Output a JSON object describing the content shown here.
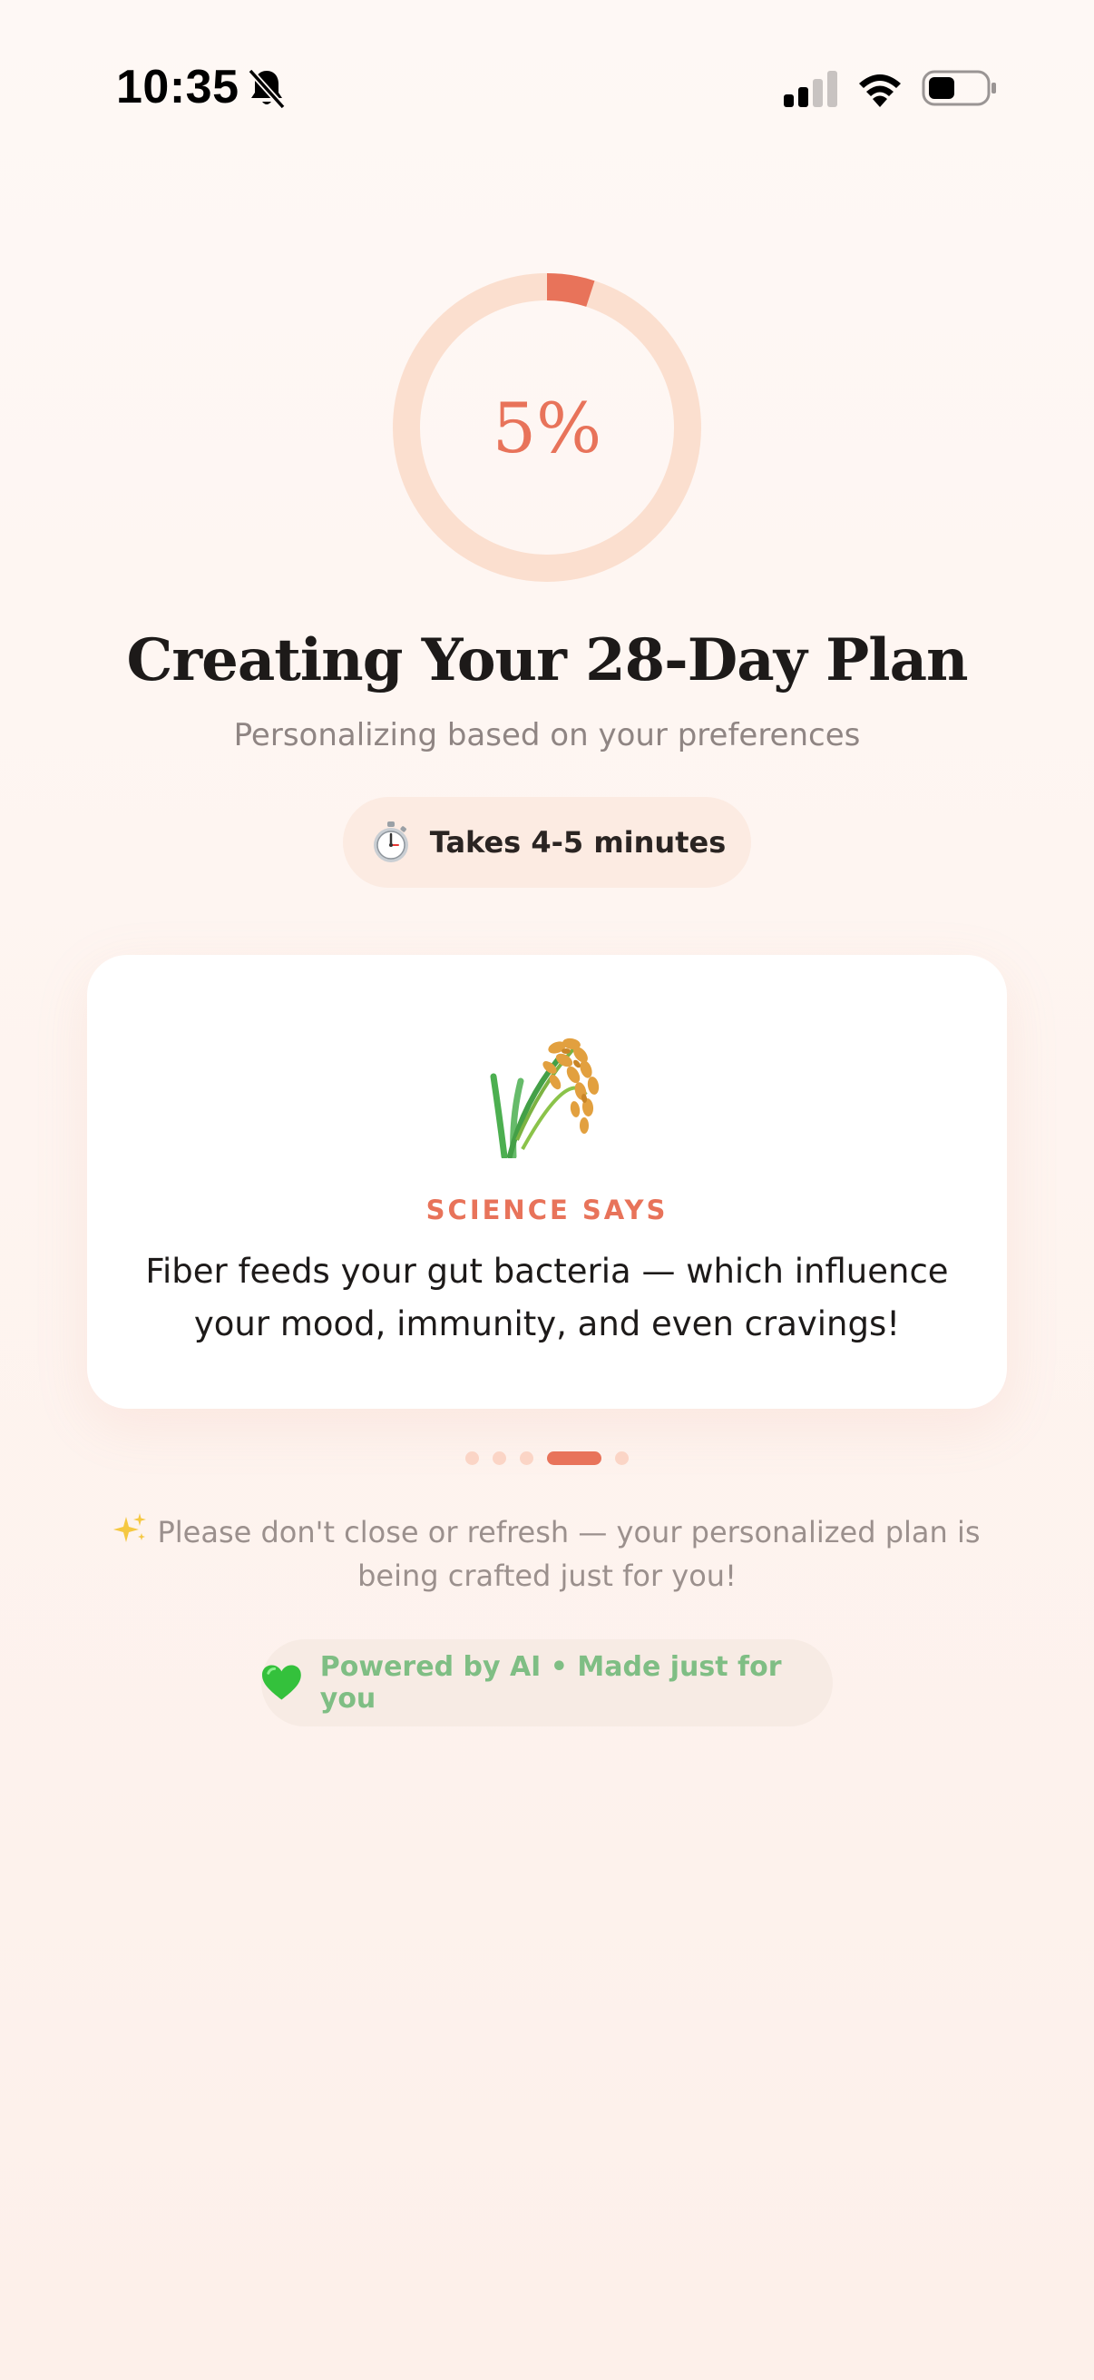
{
  "status_bar": {
    "time": "10:35",
    "icons": [
      "bell-slash-icon",
      "cellular-signal-icon",
      "wifi-icon",
      "battery-icon"
    ]
  },
  "progress": {
    "value_percent": 5,
    "label": "5%",
    "track_color": "#fbdfcf",
    "fill_color": "#e8735a"
  },
  "header": {
    "title": "Creating Your 28-Day Plan",
    "subtitle": "Personalizing based on your preferences"
  },
  "duration_pill": {
    "icon": "stopwatch-icon",
    "label": "Takes 4-5 minutes"
  },
  "fact_card": {
    "icon": "rice-sheaf-icon",
    "label": "SCIENCE SAYS",
    "text": "Fiber feeds your gut bacteria — which influence your mood, immunity, and even cravings!"
  },
  "pagination": {
    "count": 5,
    "active_index": 3
  },
  "notice": {
    "icon": "sparkles-icon",
    "text": "Please don't close or refresh — your personalized plan is being crafted just for you!"
  },
  "footer_pill": {
    "icon": "green-heart-icon",
    "label": "Powered by AI • Made just for you"
  },
  "colors": {
    "accent": "#e8735a",
    "green": "#7fbe84",
    "muted_text": "#9b908d"
  }
}
